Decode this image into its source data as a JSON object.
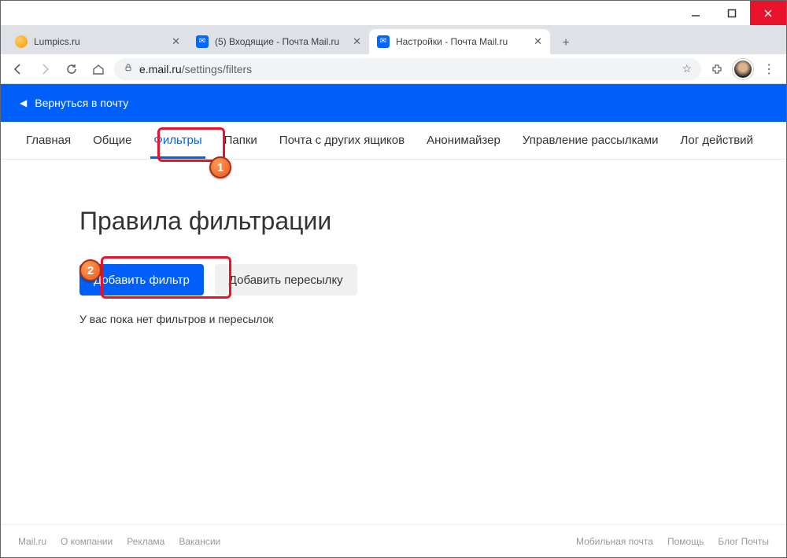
{
  "window": {
    "tabs": [
      {
        "title": "Lumpics.ru",
        "active": false,
        "favicon": "orange"
      },
      {
        "title": "(5) Входящие - Почта Mail.ru",
        "active": false,
        "favicon": "mail"
      },
      {
        "title": "Настройки - Почта Mail.ru",
        "active": true,
        "favicon": "mail"
      }
    ]
  },
  "address": {
    "host": "e.mail.ru",
    "path": "/settings/filters"
  },
  "blue_header": {
    "back_label": "Вернуться в почту"
  },
  "settings_nav": {
    "items": [
      {
        "label": "Главная",
        "active": false
      },
      {
        "label": "Общие",
        "active": false
      },
      {
        "label": "Фильтры",
        "active": true
      },
      {
        "label": "Папки",
        "active": false
      },
      {
        "label": "Почта с других ящиков",
        "active": false
      },
      {
        "label": "Анонимайзер",
        "active": false
      },
      {
        "label": "Управление рассылками",
        "active": false
      },
      {
        "label": "Лог действий",
        "active": false
      }
    ]
  },
  "main": {
    "title": "Правила фильтрации",
    "add_filter_label": "Добавить фильтр",
    "add_forward_label": "Добавить пересылку",
    "empty_text": "У вас пока нет фильтров и пересылок"
  },
  "footer": {
    "left": [
      "Mail.ru",
      "О компании",
      "Реклама",
      "Вакансии"
    ],
    "right": [
      "Мобильная почта",
      "Помощь",
      "Блог Почты"
    ]
  },
  "callouts": {
    "one": "1",
    "two": "2"
  }
}
